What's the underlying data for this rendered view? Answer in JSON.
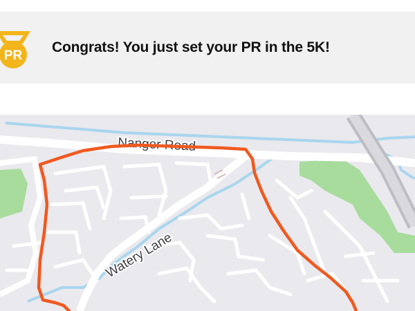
{
  "achievement": {
    "badge_text": "PR",
    "message": "Congrats! You just set your PR in the 5K!",
    "accent_color": "#f2b51b"
  },
  "map": {
    "roads": {
      "nanger_road": "Nanger Road",
      "watery_lane": "Watery Lane"
    },
    "route_color": "#f0591f",
    "water_color": "#a9d6ee",
    "park_color": "#a7dc9c",
    "land_color": "#e9e9ee"
  }
}
